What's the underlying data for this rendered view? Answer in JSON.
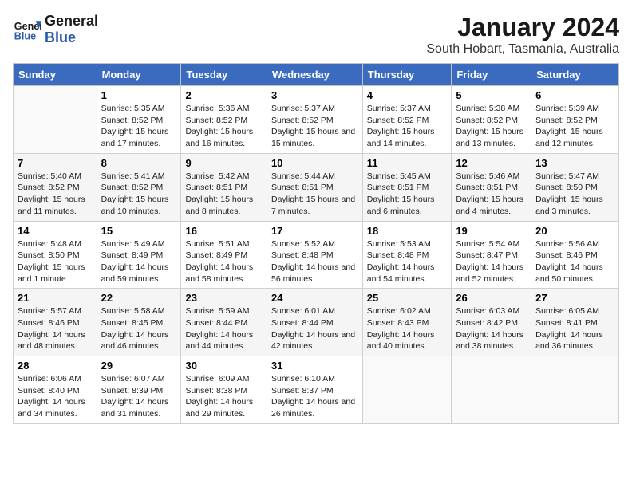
{
  "header": {
    "logo_line1": "General",
    "logo_line2": "Blue",
    "main_title": "January 2024",
    "subtitle": "South Hobart, Tasmania, Australia"
  },
  "days_of_week": [
    "Sunday",
    "Monday",
    "Tuesday",
    "Wednesday",
    "Thursday",
    "Friday",
    "Saturday"
  ],
  "weeks": [
    [
      {
        "day": "",
        "sunrise": "",
        "sunset": "",
        "daylight": ""
      },
      {
        "day": "1",
        "sunrise": "Sunrise: 5:35 AM",
        "sunset": "Sunset: 8:52 PM",
        "daylight": "Daylight: 15 hours and 17 minutes."
      },
      {
        "day": "2",
        "sunrise": "Sunrise: 5:36 AM",
        "sunset": "Sunset: 8:52 PM",
        "daylight": "Daylight: 15 hours and 16 minutes."
      },
      {
        "day": "3",
        "sunrise": "Sunrise: 5:37 AM",
        "sunset": "Sunset: 8:52 PM",
        "daylight": "Daylight: 15 hours and 15 minutes."
      },
      {
        "day": "4",
        "sunrise": "Sunrise: 5:37 AM",
        "sunset": "Sunset: 8:52 PM",
        "daylight": "Daylight: 15 hours and 14 minutes."
      },
      {
        "day": "5",
        "sunrise": "Sunrise: 5:38 AM",
        "sunset": "Sunset: 8:52 PM",
        "daylight": "Daylight: 15 hours and 13 minutes."
      },
      {
        "day": "6",
        "sunrise": "Sunrise: 5:39 AM",
        "sunset": "Sunset: 8:52 PM",
        "daylight": "Daylight: 15 hours and 12 minutes."
      }
    ],
    [
      {
        "day": "7",
        "sunrise": "Sunrise: 5:40 AM",
        "sunset": "Sunset: 8:52 PM",
        "daylight": "Daylight: 15 hours and 11 minutes."
      },
      {
        "day": "8",
        "sunrise": "Sunrise: 5:41 AM",
        "sunset": "Sunset: 8:52 PM",
        "daylight": "Daylight: 15 hours and 10 minutes."
      },
      {
        "day": "9",
        "sunrise": "Sunrise: 5:42 AM",
        "sunset": "Sunset: 8:51 PM",
        "daylight": "Daylight: 15 hours and 8 minutes."
      },
      {
        "day": "10",
        "sunrise": "Sunrise: 5:44 AM",
        "sunset": "Sunset: 8:51 PM",
        "daylight": "Daylight: 15 hours and 7 minutes."
      },
      {
        "day": "11",
        "sunrise": "Sunrise: 5:45 AM",
        "sunset": "Sunset: 8:51 PM",
        "daylight": "Daylight: 15 hours and 6 minutes."
      },
      {
        "day": "12",
        "sunrise": "Sunrise: 5:46 AM",
        "sunset": "Sunset: 8:51 PM",
        "daylight": "Daylight: 15 hours and 4 minutes."
      },
      {
        "day": "13",
        "sunrise": "Sunrise: 5:47 AM",
        "sunset": "Sunset: 8:50 PM",
        "daylight": "Daylight: 15 hours and 3 minutes."
      }
    ],
    [
      {
        "day": "14",
        "sunrise": "Sunrise: 5:48 AM",
        "sunset": "Sunset: 8:50 PM",
        "daylight": "Daylight: 15 hours and 1 minute."
      },
      {
        "day": "15",
        "sunrise": "Sunrise: 5:49 AM",
        "sunset": "Sunset: 8:49 PM",
        "daylight": "Daylight: 14 hours and 59 minutes."
      },
      {
        "day": "16",
        "sunrise": "Sunrise: 5:51 AM",
        "sunset": "Sunset: 8:49 PM",
        "daylight": "Daylight: 14 hours and 58 minutes."
      },
      {
        "day": "17",
        "sunrise": "Sunrise: 5:52 AM",
        "sunset": "Sunset: 8:48 PM",
        "daylight": "Daylight: 14 hours and 56 minutes."
      },
      {
        "day": "18",
        "sunrise": "Sunrise: 5:53 AM",
        "sunset": "Sunset: 8:48 PM",
        "daylight": "Daylight: 14 hours and 54 minutes."
      },
      {
        "day": "19",
        "sunrise": "Sunrise: 5:54 AM",
        "sunset": "Sunset: 8:47 PM",
        "daylight": "Daylight: 14 hours and 52 minutes."
      },
      {
        "day": "20",
        "sunrise": "Sunrise: 5:56 AM",
        "sunset": "Sunset: 8:46 PM",
        "daylight": "Daylight: 14 hours and 50 minutes."
      }
    ],
    [
      {
        "day": "21",
        "sunrise": "Sunrise: 5:57 AM",
        "sunset": "Sunset: 8:46 PM",
        "daylight": "Daylight: 14 hours and 48 minutes."
      },
      {
        "day": "22",
        "sunrise": "Sunrise: 5:58 AM",
        "sunset": "Sunset: 8:45 PM",
        "daylight": "Daylight: 14 hours and 46 minutes."
      },
      {
        "day": "23",
        "sunrise": "Sunrise: 5:59 AM",
        "sunset": "Sunset: 8:44 PM",
        "daylight": "Daylight: 14 hours and 44 minutes."
      },
      {
        "day": "24",
        "sunrise": "Sunrise: 6:01 AM",
        "sunset": "Sunset: 8:44 PM",
        "daylight": "Daylight: 14 hours and 42 minutes."
      },
      {
        "day": "25",
        "sunrise": "Sunrise: 6:02 AM",
        "sunset": "Sunset: 8:43 PM",
        "daylight": "Daylight: 14 hours and 40 minutes."
      },
      {
        "day": "26",
        "sunrise": "Sunrise: 6:03 AM",
        "sunset": "Sunset: 8:42 PM",
        "daylight": "Daylight: 14 hours and 38 minutes."
      },
      {
        "day": "27",
        "sunrise": "Sunrise: 6:05 AM",
        "sunset": "Sunset: 8:41 PM",
        "daylight": "Daylight: 14 hours and 36 minutes."
      }
    ],
    [
      {
        "day": "28",
        "sunrise": "Sunrise: 6:06 AM",
        "sunset": "Sunset: 8:40 PM",
        "daylight": "Daylight: 14 hours and 34 minutes."
      },
      {
        "day": "29",
        "sunrise": "Sunrise: 6:07 AM",
        "sunset": "Sunset: 8:39 PM",
        "daylight": "Daylight: 14 hours and 31 minutes."
      },
      {
        "day": "30",
        "sunrise": "Sunrise: 6:09 AM",
        "sunset": "Sunset: 8:38 PM",
        "daylight": "Daylight: 14 hours and 29 minutes."
      },
      {
        "day": "31",
        "sunrise": "Sunrise: 6:10 AM",
        "sunset": "Sunset: 8:37 PM",
        "daylight": "Daylight: 14 hours and 26 minutes."
      },
      {
        "day": "",
        "sunrise": "",
        "sunset": "",
        "daylight": ""
      },
      {
        "day": "",
        "sunrise": "",
        "sunset": "",
        "daylight": ""
      },
      {
        "day": "",
        "sunrise": "",
        "sunset": "",
        "daylight": ""
      }
    ]
  ]
}
